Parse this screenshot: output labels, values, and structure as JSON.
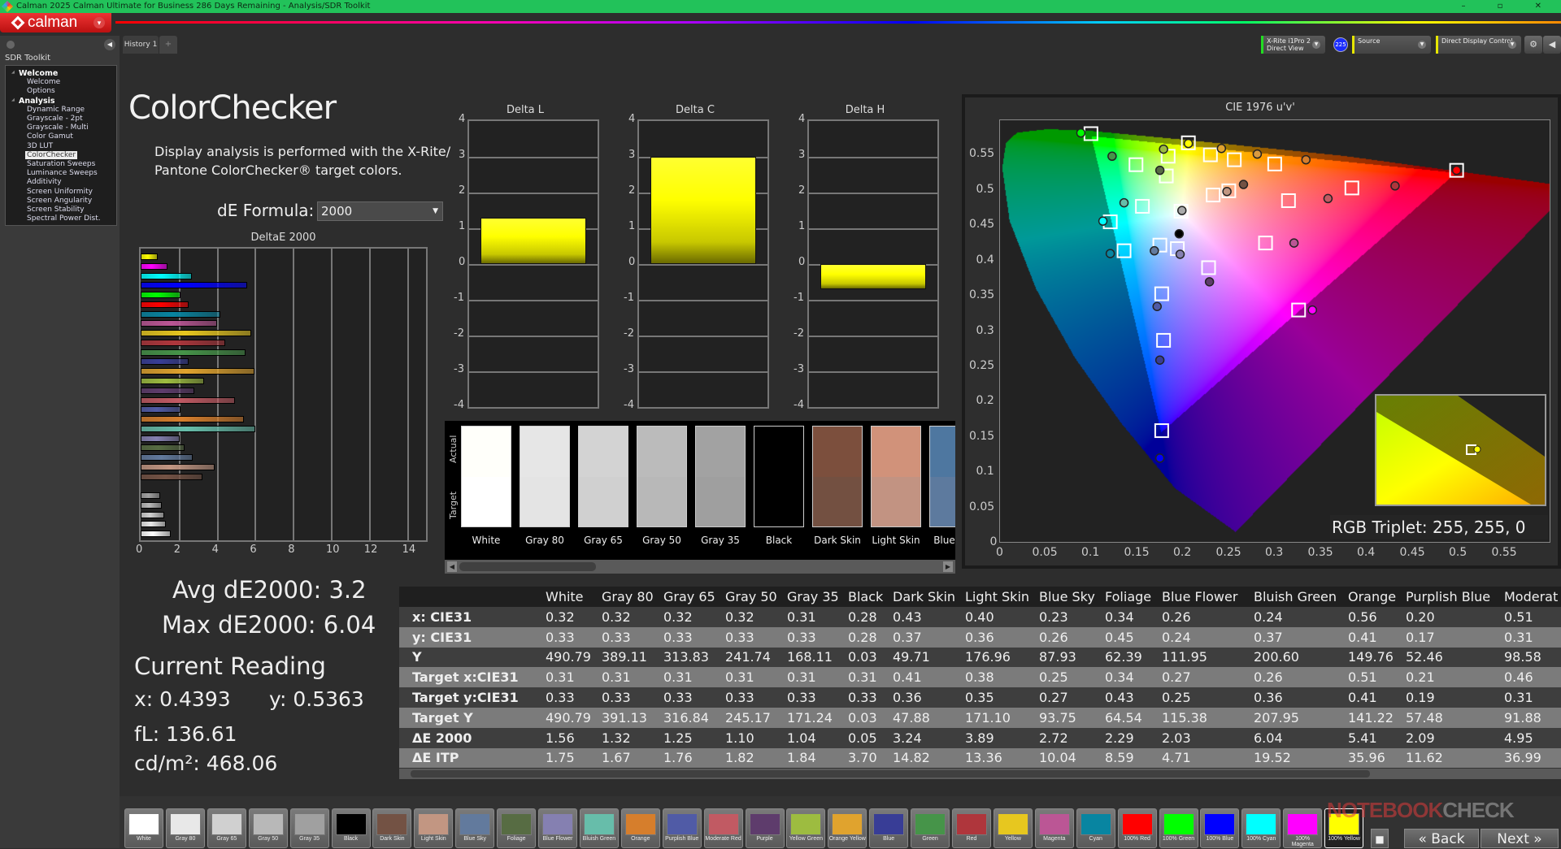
{
  "window": {
    "title": "Calman 2025 Calman Ultimate for Business 286 Days Remaining  - Analysis/SDR Toolkit",
    "controls": "– ▫ ✕"
  },
  "app": {
    "logo": "calman",
    "menu_arrow": "▾"
  },
  "tabs": [
    {
      "label": "History 1"
    }
  ],
  "add_tab": "+",
  "toolbar": {
    "meter_line1": "X-Rite i1Pro 2",
    "meter_line2": "Direct View",
    "badge": "225",
    "source": "Source",
    "display": "Direct Display Control",
    "gear": "⚙",
    "collapse": "◀",
    "colors": {
      "meter": "#22dd22",
      "source": "#e6e600",
      "display": "#e6e600"
    }
  },
  "sidebar": {
    "heading": "SDR Toolkit",
    "groups": [
      {
        "label": "Welcome",
        "items": [
          "Welcome",
          "Options"
        ]
      },
      {
        "label": "Analysis",
        "items": [
          "Dynamic Range",
          "Grayscale - 2pt",
          "Grayscale - Multi",
          "Color Gamut",
          "3D LUT",
          "ColorChecker",
          "Saturation Sweeps",
          "Luminance Sweeps",
          "Additivity",
          "Screen Uniformity",
          "Screen Angularity",
          "Screen Stability",
          "Spectral Power Dist."
        ]
      }
    ],
    "selected": "ColorChecker"
  },
  "main": {
    "title": "ColorChecker",
    "description_line1": "Display analysis is performed with the X-Rite/",
    "description_line2": "Pantone ColorChecker® target colors.",
    "formula_label": "dE Formula:",
    "formula_value": "2000"
  },
  "stats": {
    "avg": "Avg dE2000: 3.2",
    "max": "Max dE2000: 6.04",
    "current_heading": "Current Reading",
    "x": "x: 0.4393",
    "y": "y: 0.5363",
    "fl": "fL: 136.61",
    "cdm2": "cd/m²: 468.06"
  },
  "swatch_panel": {
    "actual_label": "Actual",
    "target_label": "Target",
    "patches": [
      {
        "name": "White",
        "actual": "#fffffa",
        "target": "#ffffff"
      },
      {
        "name": "Gray 80",
        "actual": "#e6e6e6",
        "target": "#e4e4e4"
      },
      {
        "name": "Gray 65",
        "actual": "#d3d3d3",
        "target": "#d0d0d0"
      },
      {
        "name": "Gray 50",
        "actual": "#bbbbbb",
        "target": "#b8b8b8"
      },
      {
        "name": "Gray 35",
        "actual": "#a2a2a2",
        "target": "#9f9f9f"
      },
      {
        "name": "Black",
        "actual": "#000000",
        "target": "#000000"
      },
      {
        "name": "Dark Skin",
        "actual": "#7c4f3d",
        "target": "#735041"
      },
      {
        "name": "Light Skin",
        "actual": "#d1927a",
        "target": "#c29382"
      },
      {
        "name": "Blue Sky",
        "actual": "#4e77a0",
        "target": "#5d7a9e"
      }
    ]
  },
  "table": {
    "columns": [
      "White",
      "Gray 80",
      "Gray 65",
      "Gray 50",
      "Gray 35",
      "Black",
      "Dark Skin",
      "Light Skin",
      "Blue Sky",
      "Foliage",
      "Blue Flower",
      "Bluish Green",
      "Orange",
      "Purplish Blue",
      "Moderat"
    ],
    "rows": [
      {
        "label": "x: CIE31",
        "values": [
          "0.32",
          "0.32",
          "0.32",
          "0.32",
          "0.31",
          "0.28",
          "0.43",
          "0.40",
          "0.23",
          "0.34",
          "0.26",
          "0.24",
          "0.56",
          "0.20",
          "0.51"
        ]
      },
      {
        "label": "y: CIE31",
        "values": [
          "0.33",
          "0.33",
          "0.33",
          "0.33",
          "0.33",
          "0.28",
          "0.37",
          "0.36",
          "0.26",
          "0.45",
          "0.24",
          "0.37",
          "0.41",
          "0.17",
          "0.31"
        ]
      },
      {
        "label": "Y",
        "values": [
          "490.79",
          "389.11",
          "313.83",
          "241.74",
          "168.11",
          "0.03",
          "49.71",
          "176.96",
          "87.93",
          "62.39",
          "111.95",
          "200.60",
          "149.76",
          "52.46",
          "98.58"
        ]
      },
      {
        "label": "Target x:CIE31",
        "values": [
          "0.31",
          "0.31",
          "0.31",
          "0.31",
          "0.31",
          "0.31",
          "0.41",
          "0.38",
          "0.25",
          "0.34",
          "0.27",
          "0.26",
          "0.51",
          "0.21",
          "0.46"
        ]
      },
      {
        "label": "Target y:CIE31",
        "values": [
          "0.33",
          "0.33",
          "0.33",
          "0.33",
          "0.33",
          "0.33",
          "0.36",
          "0.35",
          "0.27",
          "0.43",
          "0.25",
          "0.36",
          "0.41",
          "0.19",
          "0.31"
        ]
      },
      {
        "label": "Target Y",
        "values": [
          "490.79",
          "391.13",
          "316.84",
          "245.17",
          "171.24",
          "0.03",
          "47.88",
          "171.10",
          "93.75",
          "64.54",
          "115.38",
          "207.95",
          "141.22",
          "57.48",
          "91.88"
        ]
      },
      {
        "label": "ΔE 2000",
        "values": [
          "1.56",
          "1.32",
          "1.25",
          "1.10",
          "1.04",
          "0.05",
          "3.24",
          "3.89",
          "2.72",
          "2.29",
          "2.03",
          "6.04",
          "5.41",
          "2.09",
          "4.95"
        ]
      },
      {
        "label": "ΔE ITP",
        "values": [
          "1.75",
          "1.67",
          "1.76",
          "1.82",
          "1.84",
          "3.70",
          "14.82",
          "13.36",
          "10.04",
          "8.59",
          "4.71",
          "19.52",
          "35.96",
          "11.62",
          "36.99"
        ]
      }
    ]
  },
  "patches": [
    {
      "name": "White",
      "color": "#ffffff"
    },
    {
      "name": "Gray 80",
      "color": "#e8e8e8"
    },
    {
      "name": "Gray 65",
      "color": "#d0d0d0"
    },
    {
      "name": "Gray 50",
      "color": "#b8b8b8"
    },
    {
      "name": "Gray 35",
      "color": "#a0a0a0"
    },
    {
      "name": "Black",
      "color": "#000000"
    },
    {
      "name": "Dark Skin",
      "color": "#735244"
    },
    {
      "name": "Light Skin",
      "color": "#c29682"
    },
    {
      "name": "Blue Sky",
      "color": "#627a9d"
    },
    {
      "name": "Foliage",
      "color": "#576c43"
    },
    {
      "name": "Blue Flower",
      "color": "#8580b1"
    },
    {
      "name": "Bluish Green",
      "color": "#67bdaa"
    },
    {
      "name": "Orange",
      "color": "#d67e2c"
    },
    {
      "name": "Purplish Blue",
      "color": "#505ba6"
    },
    {
      "name": "Moderate Red",
      "color": "#c15a63"
    },
    {
      "name": "Purple",
      "color": "#5e3c6c"
    },
    {
      "name": "Yellow Green",
      "color": "#9dbc40"
    },
    {
      "name": "Orange Yellow",
      "color": "#e0a32e"
    },
    {
      "name": "Blue",
      "color": "#383d96"
    },
    {
      "name": "Green",
      "color": "#469449"
    },
    {
      "name": "Red",
      "color": "#af363c"
    },
    {
      "name": "Yellow",
      "color": "#e7c71f"
    },
    {
      "name": "Magenta",
      "color": "#bb5695"
    },
    {
      "name": "Cyan",
      "color": "#0885a1"
    },
    {
      "name": "100% Red",
      "color": "#ff0000"
    },
    {
      "name": "100% Green",
      "color": "#00ff00"
    },
    {
      "name": "100% Blue",
      "color": "#0000ff"
    },
    {
      "name": "100% Cyan",
      "color": "#00ffff"
    },
    {
      "name": "100% Magenta",
      "color": "#ff00ff"
    },
    {
      "name": "100% Yellow",
      "color": "#ffff00"
    }
  ],
  "selected_patch": "100% Yellow",
  "nav": {
    "back": "Back",
    "next": "Next",
    "back_icon": "«",
    "next_icon": "»"
  },
  "watermark": {
    "a": "NOTEBOOK",
    "b": "CHECK"
  },
  "cie_readout": "RGB Triplet: 255, 255, 0",
  "chart_data": [
    {
      "type": "bar",
      "orientation": "horizontal",
      "title": "DeltaE 2000",
      "xlim": [
        0,
        15
      ],
      "xticks": [
        "0",
        "2",
        "4",
        "6",
        "8",
        "10",
        "12",
        "14"
      ],
      "grid": true,
      "categories": [
        "White",
        "Gray 80",
        "Gray 65",
        "Gray 50",
        "Gray 35",
        "Black",
        "Dark Skin",
        "Light Skin",
        "Blue Sky",
        "Foliage",
        "Blue Flower",
        "Bluish Green",
        "Orange",
        "Purplish Blue",
        "Moderate Red",
        "Purple",
        "Yellow Green",
        "Orange Yellow",
        "Blue",
        "Green",
        "Red",
        "Yellow",
        "Magenta",
        "Cyan",
        "100% Red",
        "100% Green",
        "100% Blue",
        "100% Cyan",
        "100% Magenta",
        "100% Yellow"
      ],
      "values": [
        1.56,
        1.32,
        1.25,
        1.1,
        1.04,
        0.05,
        3.24,
        3.89,
        2.72,
        2.29,
        2.03,
        6.04,
        5.41,
        2.09,
        4.95,
        2.8,
        3.35,
        6.0,
        2.5,
        5.5,
        4.45,
        5.8,
        4.0,
        4.2,
        2.5,
        2.1,
        5.6,
        2.7,
        1.4,
        0.9
      ]
    },
    {
      "type": "bar",
      "title": "Delta L",
      "ylim": [
        -4,
        4
      ],
      "yticks": [
        "4",
        "3",
        "2",
        "1",
        "0",
        "-1",
        "-2",
        "-3",
        "-4"
      ],
      "values": [
        1.3
      ],
      "color": "#ffff00"
    },
    {
      "type": "bar",
      "title": "Delta C",
      "ylim": [
        -4,
        4
      ],
      "yticks": [
        "4",
        "3",
        "2",
        "1",
        "0",
        "-1",
        "-2",
        "-3",
        "-4"
      ],
      "values": [
        3.0
      ],
      "color": "#ffff00"
    },
    {
      "type": "bar",
      "title": "Delta H",
      "ylim": [
        -4,
        4
      ],
      "yticks": [
        "4",
        "3",
        "2",
        "1",
        "0",
        "-1",
        "-2",
        "-3",
        "-4"
      ],
      "values": [
        -0.7
      ],
      "color": "#ffff00"
    },
    {
      "type": "scatter",
      "title": "CIE 1976 u'v'",
      "xlim": [
        0,
        0.6
      ],
      "ylim": [
        0,
        0.6
      ],
      "xticks": [
        "0",
        "0.05",
        "0.1",
        "0.15",
        "0.2",
        "0.25",
        "0.3",
        "0.35",
        "0.4",
        "0.45",
        "0.5",
        "0.55"
      ],
      "yticks": [
        "0",
        "0.05",
        "0.1",
        "0.15",
        "0.2",
        "0.25",
        "0.3",
        "0.35",
        "0.4",
        "0.45",
        "0.5",
        "0.55"
      ],
      "targets": [
        [
          0.099,
          0.581
        ],
        [
          0.205,
          0.568
        ],
        [
          0.183,
          0.549
        ],
        [
          0.229,
          0.551
        ],
        [
          0.255,
          0.544
        ],
        [
          0.299,
          0.538
        ],
        [
          0.148,
          0.537
        ],
        [
          0.181,
          0.521
        ],
        [
          0.497,
          0.529
        ],
        [
          0.383,
          0.504
        ],
        [
          0.249,
          0.5
        ],
        [
          0.232,
          0.494
        ],
        [
          0.314,
          0.486
        ],
        [
          0.155,
          0.478
        ],
        [
          0.197,
          0.471
        ],
        [
          0.12,
          0.456
        ],
        [
          0.174,
          0.423
        ],
        [
          0.193,
          0.418
        ],
        [
          0.289,
          0.426
        ],
        [
          0.135,
          0.415
        ],
        [
          0.227,
          0.391
        ],
        [
          0.176,
          0.354
        ],
        [
          0.325,
          0.331
        ],
        [
          0.178,
          0.288
        ],
        [
          0.176,
          0.16
        ]
      ],
      "measured": [
        {
          "u": 0.088,
          "v": 0.582,
          "color": "#00ff00"
        },
        {
          "u": 0.122,
          "v": 0.549,
          "color": "#469449"
        },
        {
          "u": 0.178,
          "v": 0.559,
          "color": "#9dbc40"
        },
        {
          "u": 0.205,
          "v": 0.567,
          "color": "#ffff00"
        },
        {
          "u": 0.241,
          "v": 0.56,
          "color": "#e0a32e"
        },
        {
          "u": 0.28,
          "v": 0.552,
          "color": "#d99a40"
        },
        {
          "u": 0.333,
          "v": 0.544,
          "color": "#d67e2c"
        },
        {
          "u": 0.497,
          "v": 0.529,
          "color": "#ff0000"
        },
        {
          "u": 0.174,
          "v": 0.529,
          "color": "#576c43"
        },
        {
          "u": 0.265,
          "v": 0.509,
          "color": "#735244"
        },
        {
          "u": 0.247,
          "v": 0.499,
          "color": "#c29682"
        },
        {
          "u": 0.43,
          "v": 0.507,
          "color": "#af363c"
        },
        {
          "u": 0.357,
          "v": 0.489,
          "color": "#c15a63"
        },
        {
          "u": 0.135,
          "v": 0.483,
          "color": "#67bdaa"
        },
        {
          "u": 0.198,
          "v": 0.472,
          "color": "#aaaaaa"
        },
        {
          "u": 0.112,
          "v": 0.457,
          "color": "#00ffff"
        },
        {
          "u": 0.195,
          "v": 0.439,
          "color": "#000000"
        },
        {
          "u": 0.12,
          "v": 0.411,
          "color": "#0885a1"
        },
        {
          "u": 0.168,
          "v": 0.415,
          "color": "#627a9d"
        },
        {
          "u": 0.196,
          "v": 0.41,
          "color": "#8580b1"
        },
        {
          "u": 0.32,
          "v": 0.426,
          "color": "#bb5695"
        },
        {
          "u": 0.228,
          "v": 0.371,
          "color": "#5e3c6c"
        },
        {
          "u": 0.171,
          "v": 0.336,
          "color": "#505ba6"
        },
        {
          "u": 0.34,
          "v": 0.331,
          "color": "#ff00ff"
        },
        {
          "u": 0.174,
          "v": 0.26,
          "color": "#383d96"
        },
        {
          "u": 0.174,
          "v": 0.121,
          "color": "#0000ff"
        }
      ]
    }
  ]
}
